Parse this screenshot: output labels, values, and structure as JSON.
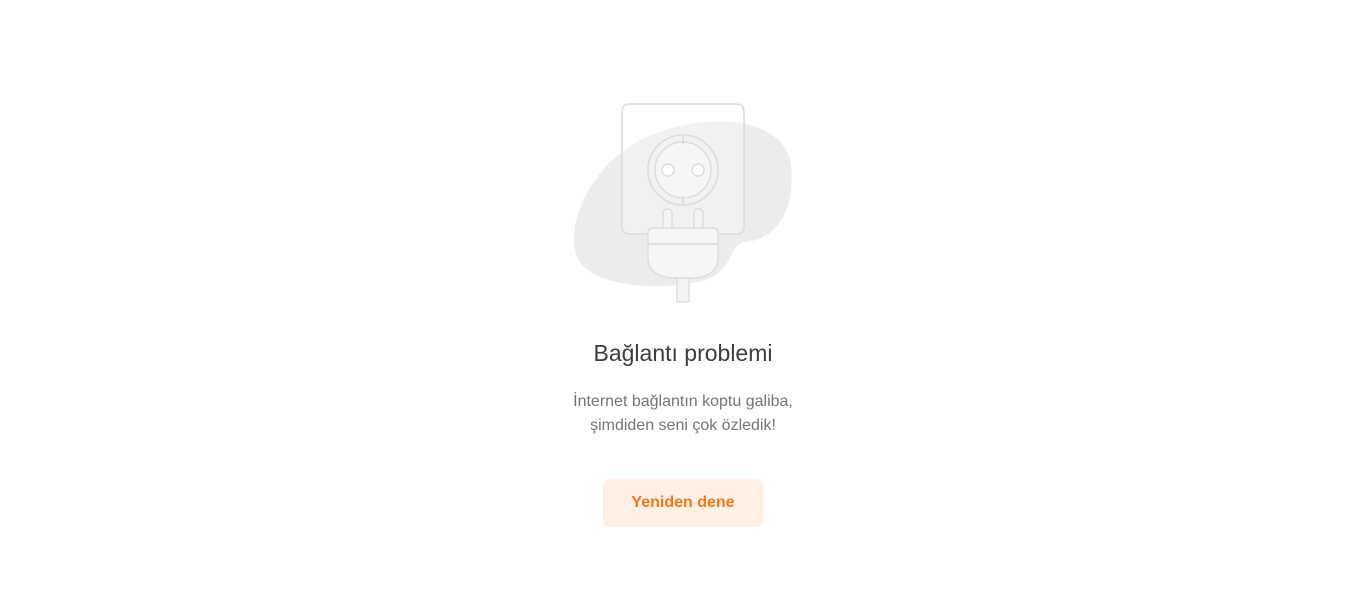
{
  "error": {
    "illustration_icon": "unplugged-socket-icon",
    "title": "Bağlantı problemi",
    "message_line_1": "İnternet bağlantın koptu galiba,",
    "message_line_2": "şimdiden seni çok özledik!",
    "retry_label": "Yeniden dene"
  },
  "colors": {
    "background": "#ffffff",
    "title": "#3d3d3d",
    "message": "#757575",
    "button_bg": "#fff0e6",
    "button_text": "#f27a1a",
    "illustration_blob": "#ececec",
    "illustration_stroke": "#dcdcdc"
  }
}
